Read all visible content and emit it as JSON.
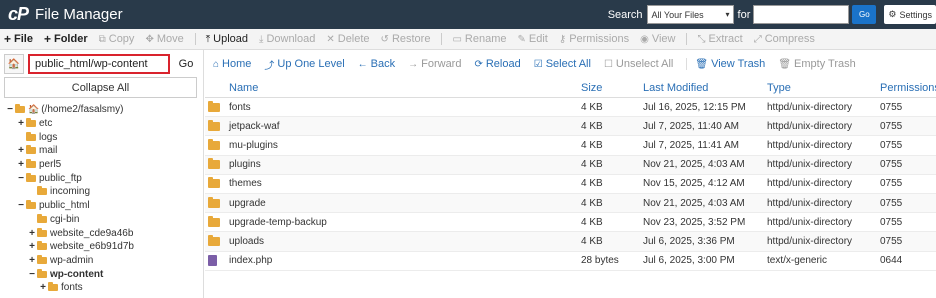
{
  "header": {
    "logo": "cP",
    "title": "File Manager",
    "search_label": "Search",
    "search_scope": "All Your Files",
    "for_label": "for",
    "search_value": "",
    "go_label": "Go",
    "settings_label": "Settings"
  },
  "toolbar": {
    "items": [
      {
        "icon": "+",
        "label": "File",
        "state": "active-bold"
      },
      {
        "icon": "+",
        "label": "Folder",
        "state": "active-bold"
      },
      {
        "icon": "⧉",
        "label": "Copy",
        "state": "disabled"
      },
      {
        "icon": "✥",
        "label": "Move",
        "state": "disabled"
      },
      {
        "icon": "⤒",
        "label": "Upload",
        "state": "active"
      },
      {
        "icon": "⤓",
        "label": "Download",
        "state": "disabled"
      },
      {
        "icon": "✕",
        "label": "Delete",
        "state": "disabled"
      },
      {
        "icon": "↺",
        "label": "Restore",
        "state": "disabled"
      },
      {
        "icon": "▭",
        "label": "Rename",
        "state": "disabled"
      },
      {
        "icon": "✎",
        "label": "Edit",
        "state": "disabled"
      },
      {
        "icon": "⚷",
        "label": "Permissions",
        "state": "disabled"
      },
      {
        "icon": "◉",
        "label": "View",
        "state": "disabled"
      },
      {
        "icon": "⤡",
        "label": "Extract",
        "state": "disabled"
      },
      {
        "icon": "⤢",
        "label": "Compress",
        "state": "disabled"
      }
    ]
  },
  "sidebar": {
    "path_value": "public_html/wp-content",
    "go_label": "Go",
    "collapse_label": "Collapse All",
    "tree": [
      {
        "toggle": "−",
        "label": "(/home2/fasalsmy)",
        "indent": 0,
        "home": true
      },
      {
        "toggle": "+",
        "label": "etc",
        "indent": 1
      },
      {
        "toggle": "",
        "label": "logs",
        "indent": 1
      },
      {
        "toggle": "+",
        "label": "mail",
        "indent": 1
      },
      {
        "toggle": "+",
        "label": "perl5",
        "indent": 1
      },
      {
        "toggle": "−",
        "label": "public_ftp",
        "indent": 1
      },
      {
        "toggle": "",
        "label": "incoming",
        "indent": 2
      },
      {
        "toggle": "−",
        "label": "public_html",
        "indent": 1
      },
      {
        "toggle": "",
        "label": "cgi-bin",
        "indent": 2
      },
      {
        "toggle": "+",
        "label": "website_cde9a46b",
        "indent": 2
      },
      {
        "toggle": "+",
        "label": "website_e6b91d7b",
        "indent": 2
      },
      {
        "toggle": "+",
        "label": "wp-admin",
        "indent": 2
      },
      {
        "toggle": "−",
        "label": "wp-content",
        "indent": 2,
        "bold": true
      },
      {
        "toggle": "+",
        "label": "fonts",
        "indent": 3
      }
    ]
  },
  "nav": {
    "items": [
      {
        "icon": "⌂",
        "label": "Home",
        "state": "active"
      },
      {
        "icon": "⤴",
        "label": "Up One Level",
        "state": "active"
      },
      {
        "icon": "←",
        "label": "Back",
        "state": "active"
      },
      {
        "icon": "→",
        "label": "Forward",
        "state": "disabled"
      },
      {
        "icon": "⟳",
        "label": "Reload",
        "state": "active"
      },
      {
        "icon": "☑",
        "label": "Select All",
        "state": "active"
      },
      {
        "icon": "☐",
        "label": "Unselect All",
        "state": "disabled"
      },
      {
        "icon": "🗑",
        "label": "View Trash",
        "state": "active"
      },
      {
        "icon": "🗑",
        "label": "Empty Trash",
        "state": "disabled"
      }
    ]
  },
  "table": {
    "headers": {
      "name": "Name",
      "size": "Size",
      "modified": "Last Modified",
      "type": "Type",
      "perms": "Permissions"
    },
    "rows": [
      {
        "kind": "folder",
        "name": "fonts",
        "size": "4 KB",
        "modified": "Jul 16, 2025, 12:15 PM",
        "type": "httpd/unix-directory",
        "perms": "0755"
      },
      {
        "kind": "folder",
        "name": "jetpack-waf",
        "size": "4 KB",
        "modified": "Jul 7, 2025, 11:40 AM",
        "type": "httpd/unix-directory",
        "perms": "0755"
      },
      {
        "kind": "folder",
        "name": "mu-plugins",
        "size": "4 KB",
        "modified": "Jul 7, 2025, 11:41 AM",
        "type": "httpd/unix-directory",
        "perms": "0755"
      },
      {
        "kind": "folder",
        "name": "plugins",
        "size": "4 KB",
        "modified": "Nov 21, 2025, 4:03 AM",
        "type": "httpd/unix-directory",
        "perms": "0755"
      },
      {
        "kind": "folder",
        "name": "themes",
        "size": "4 KB",
        "modified": "Nov 15, 2025, 4:12 AM",
        "type": "httpd/unix-directory",
        "perms": "0755"
      },
      {
        "kind": "folder",
        "name": "upgrade",
        "size": "4 KB",
        "modified": "Nov 21, 2025, 4:03 AM",
        "type": "httpd/unix-directory",
        "perms": "0755"
      },
      {
        "kind": "folder",
        "name": "upgrade-temp-backup",
        "size": "4 KB",
        "modified": "Nov 23, 2025, 3:52 PM",
        "type": "httpd/unix-directory",
        "perms": "0755"
      },
      {
        "kind": "folder",
        "name": "uploads",
        "size": "4 KB",
        "modified": "Jul 6, 2025, 3:36 PM",
        "type": "httpd/unix-directory",
        "perms": "0755"
      },
      {
        "kind": "file",
        "name": "index.php",
        "size": "28 bytes",
        "modified": "Jul 6, 2025, 3:00 PM",
        "type": "text/x-generic",
        "perms": "0644"
      }
    ]
  }
}
